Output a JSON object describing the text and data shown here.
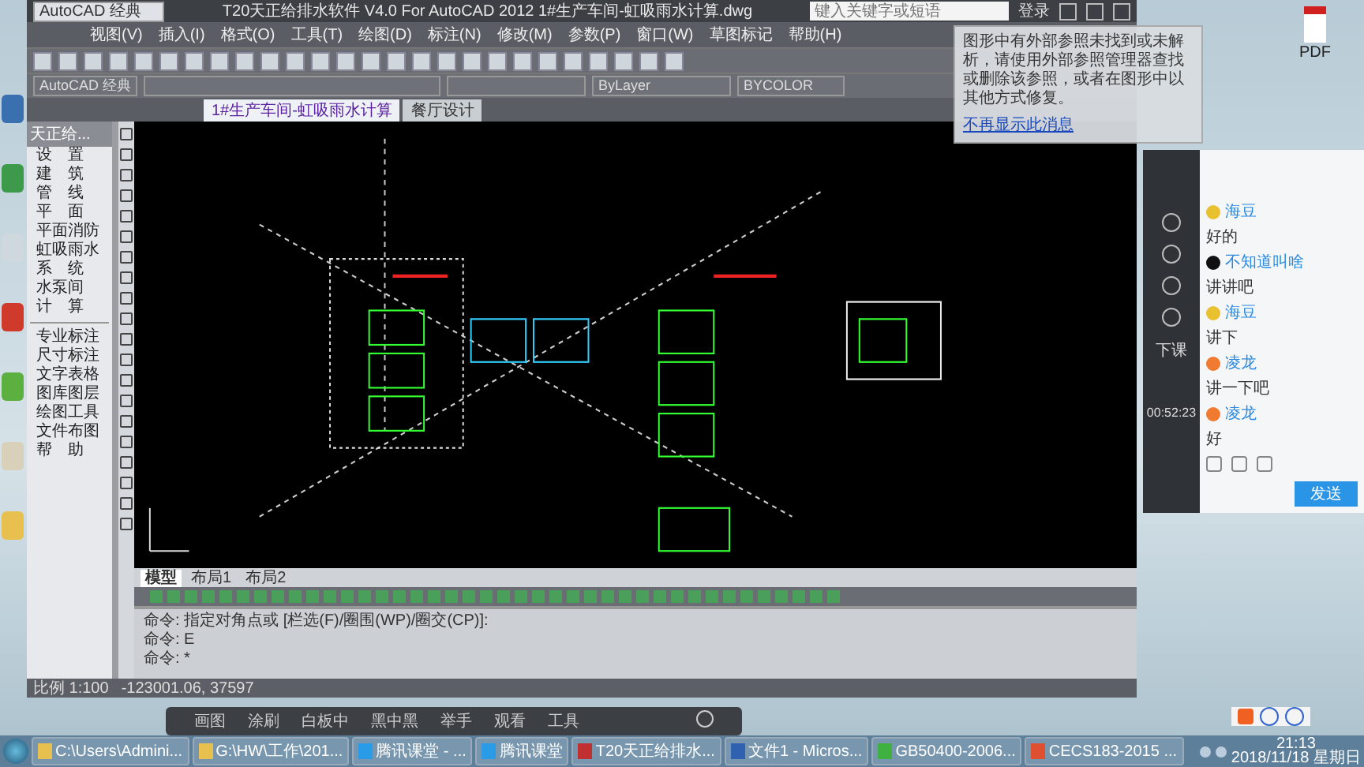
{
  "cad_window": {
    "title": "T20天正给排水软件 V4.0 For AutoCAD 2012    1#生产车间-虹吸雨水计算.dwg",
    "workspace": "AutoCAD 经典",
    "search_placeholder": "键入关键字或短语",
    "login": "登录",
    "menu": [
      "视图(V)",
      "插入(I)",
      "格式(O)",
      "工具(T)",
      "绘图(D)",
      "标注(N)",
      "修改(M)",
      "参数(P)",
      "窗口(W)",
      "草图标记",
      "帮助(H)"
    ],
    "toolbar": {
      "workspace": "AutoCAD 经典",
      "linetype": "ByLayer",
      "plotstyle": "BYCOLOR"
    },
    "doc_tabs": [
      {
        "label": "1#生产车间-虹吸雨水计算",
        "selected": true
      },
      {
        "label": "餐厅设计",
        "selected": false
      }
    ],
    "palette": {
      "title": "天正给...",
      "groups": [
        [
          "设　置",
          "建　筑",
          "管　线",
          "平　面",
          "平面消防",
          "虹吸雨水",
          "系　统",
          "水泵间",
          "计　算"
        ],
        [
          "专业标注",
          "尺寸标注",
          "文字表格",
          "图库图层",
          "绘图工具",
          "文件布图",
          "帮　助"
        ]
      ]
    },
    "layout_tabs": [
      {
        "label": "模型",
        "selected": true
      },
      {
        "label": "布局1",
        "selected": false
      },
      {
        "label": "布局2",
        "selected": false
      }
    ],
    "command_lines": [
      "命令: 指定对角点或 [栏选(F)/圈围(WP)/圈交(CP)]:",
      "命令: E",
      "命令: *"
    ],
    "status": {
      "scale": "比例 1:100",
      "coords": "-123001.06, 37597"
    }
  },
  "notification": {
    "text": "图形中有外部参照未找到或未解析，请使用外部参照管理器查找或删除该参照，或者在图形中以其他方式修复。",
    "link": "不再显示此消息"
  },
  "chat": {
    "side": {
      "end_class": "下课",
      "timer": "00:52:23"
    },
    "messages": [
      {
        "user": "海豆",
        "text": "好的",
        "color": "#e8c030"
      },
      {
        "user": "不知道叫啥",
        "text": "讲讲吧",
        "color": "#101010"
      },
      {
        "user": "海豆",
        "text": "讲下",
        "color": "#e8c030"
      },
      {
        "user": "凌龙",
        "text": "讲一下吧",
        "color": "#f07a30"
      },
      {
        "user": "凌龙",
        "text": "好",
        "color": "#f07a30"
      }
    ],
    "send": "发送"
  },
  "class_toolbar": [
    "画图",
    "涂刷",
    "白板中",
    "黑中黑",
    "举手",
    "观看",
    "工具"
  ],
  "taskbar": {
    "items": [
      {
        "label": "C:\\Users\\Admini...",
        "kind": "folder"
      },
      {
        "label": "G:\\HW\\工作\\201...",
        "kind": "folder"
      },
      {
        "label": "腾讯课堂 - ...",
        "kind": "classroom"
      },
      {
        "label": "腾讯课堂",
        "kind": "classroom"
      },
      {
        "label": "T20天正给排水...",
        "kind": "cad"
      },
      {
        "label": "文件1 - Micros...",
        "kind": "doc"
      },
      {
        "label": "GB50400-2006...",
        "kind": "viewer"
      },
      {
        "label": "CECS183-2015 ...",
        "kind": "pdf"
      }
    ],
    "time": "21:13",
    "date": "2018/11/18 星期日"
  },
  "desktop_file": {
    "label": "PDF"
  }
}
